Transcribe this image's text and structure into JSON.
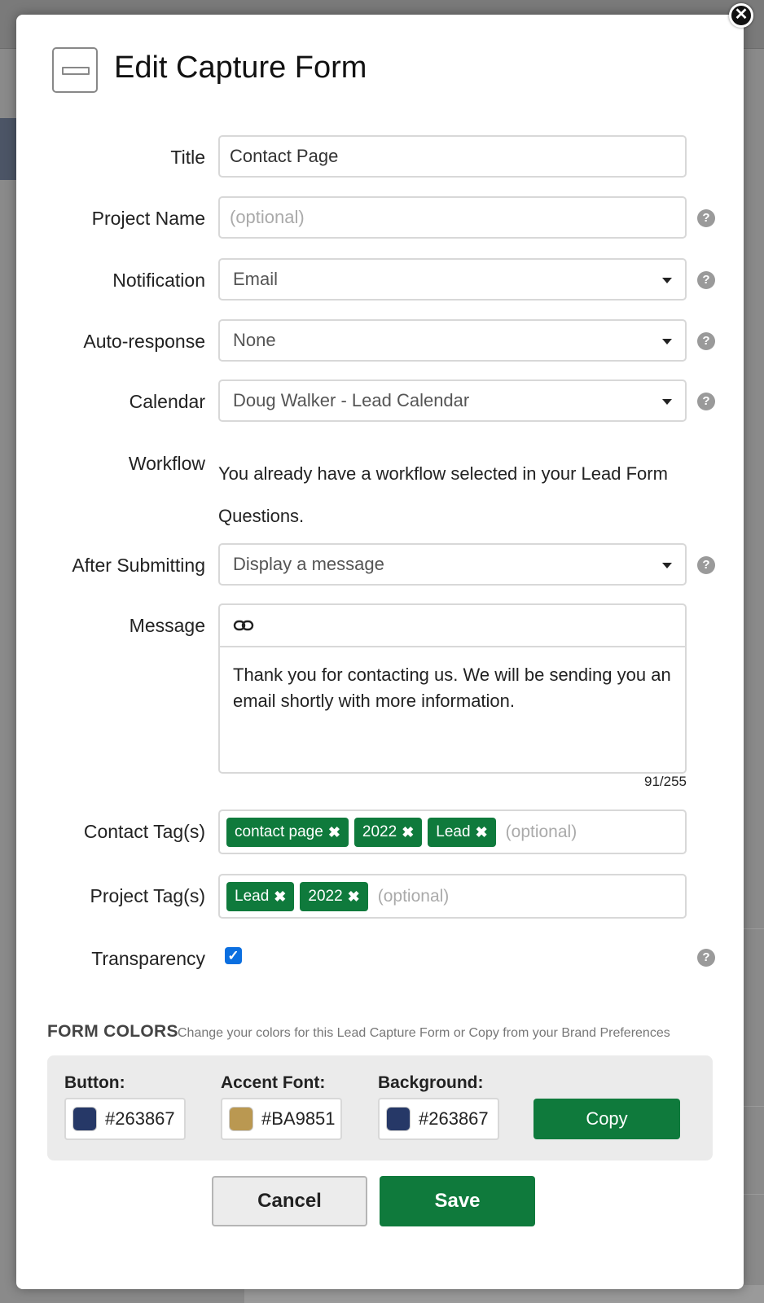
{
  "modal": {
    "title": "Edit Capture Form",
    "close_glyph": "✕"
  },
  "form": {
    "title_label": "Title",
    "title_value": "Contact Page",
    "project_label": "Project Name",
    "project_placeholder": "(optional)",
    "notification_label": "Notification",
    "notification_value": "Email",
    "autoresponse_label": "Auto-response",
    "autoresponse_value": "None",
    "calendar_label": "Calendar",
    "calendar_value": "Doug Walker - Lead Calendar",
    "workflow_label": "Workflow",
    "workflow_text": "You already have a workflow selected in your Lead Form Questions.",
    "after_label": "After Submitting",
    "after_value": "Display a message",
    "message_label": "Message",
    "message_text": "Thank you for contacting us. We will be sending you an email shortly with more information.",
    "message_count": "91/255",
    "contact_tags_label": "Contact Tag(s)",
    "contact_tags": [
      "contact page",
      "2022",
      "Lead"
    ],
    "project_tags_label": "Project Tag(s)",
    "project_tags": [
      "Lead",
      "2022"
    ],
    "tags_placeholder": "(optional)",
    "transparency_label": "Transparency",
    "transparency_checked": true,
    "help_glyph": "?"
  },
  "colors": {
    "heading": "FORM COLORS",
    "subheading": "Change your colors for this Lead Capture Form or Copy from your Brand Preferences",
    "button_label": "Button:",
    "button_value": "#263867",
    "accent_label": "Accent Font:",
    "accent_value": "#BA9851",
    "background_label": "Background:",
    "background_value": "#263867",
    "copy_label": "Copy"
  },
  "actions": {
    "cancel_label": "Cancel",
    "save_label": "Save"
  },
  "theme": {
    "primary_green": "#0f7a3c",
    "checkbox_blue": "#0b6fe0"
  }
}
